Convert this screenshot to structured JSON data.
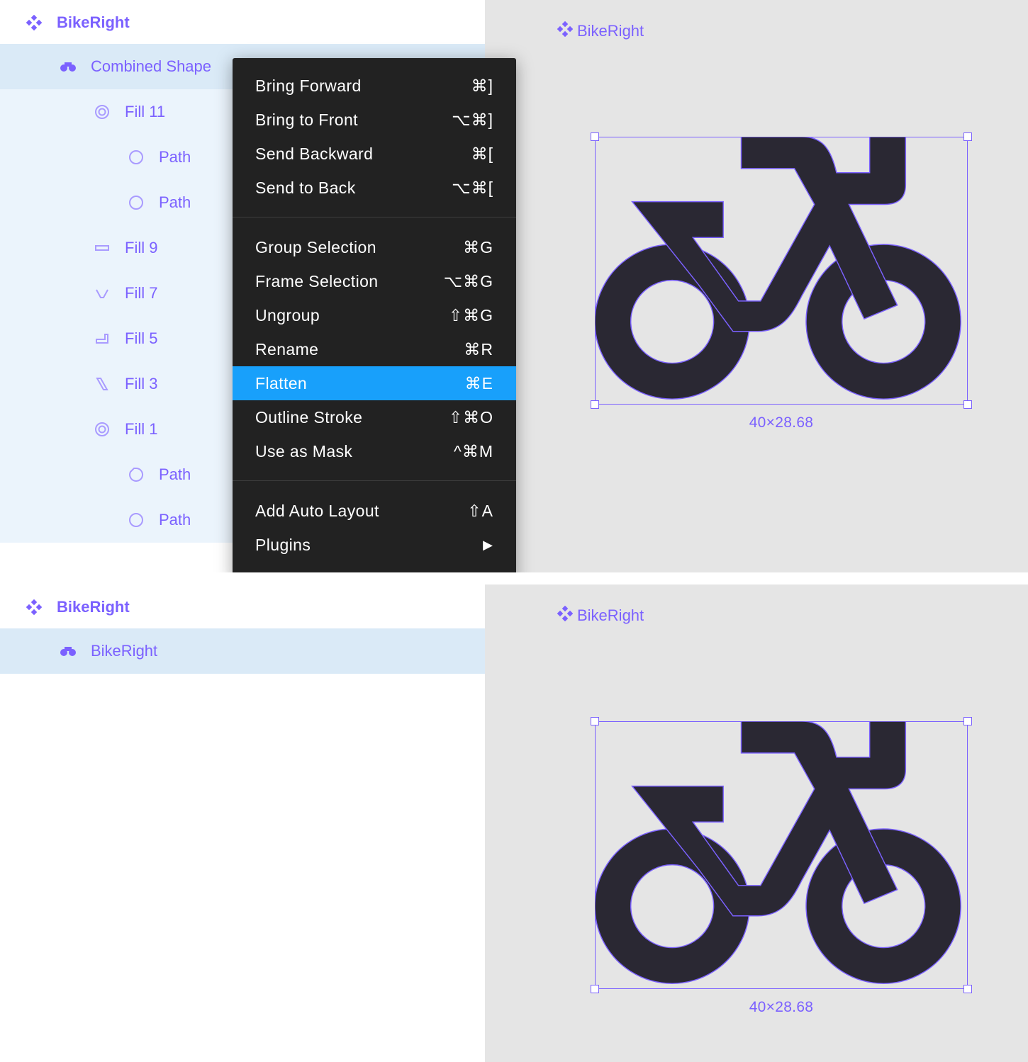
{
  "top": {
    "layers": {
      "frame_label": "BikeRight",
      "items": [
        {
          "label": "Combined Shape"
        },
        {
          "label": "Fill 11"
        },
        {
          "label": "Path"
        },
        {
          "label": "Path"
        },
        {
          "label": "Fill 9"
        },
        {
          "label": "Fill 7"
        },
        {
          "label": "Fill 5"
        },
        {
          "label": "Fill 3"
        },
        {
          "label": "Fill 1"
        },
        {
          "label": "Path"
        },
        {
          "label": "Path"
        }
      ]
    },
    "canvas": {
      "frame_label": "BikeRight",
      "dimensions": "40×28.68"
    },
    "context_menu": {
      "items": [
        {
          "label": "Bring Forward",
          "shortcut": "⌘]"
        },
        {
          "label": "Bring to Front",
          "shortcut": "⌥⌘]"
        },
        {
          "label": "Send Backward",
          "shortcut": "⌘["
        },
        {
          "label": "Send to Back",
          "shortcut": "⌥⌘["
        },
        {
          "label": "Group Selection",
          "shortcut": "⌘G"
        },
        {
          "label": "Frame Selection",
          "shortcut": "⌥⌘G"
        },
        {
          "label": "Ungroup",
          "shortcut": "⇧⌘G"
        },
        {
          "label": "Rename",
          "shortcut": "⌘R"
        },
        {
          "label": "Flatten",
          "shortcut": "⌘E"
        },
        {
          "label": "Outline Stroke",
          "shortcut": "⇧⌘O"
        },
        {
          "label": "Use as Mask",
          "shortcut": "^⌘M"
        },
        {
          "label": "Add Auto Layout",
          "shortcut": "⇧A"
        },
        {
          "label": "Plugins",
          "shortcut": "▶"
        }
      ],
      "highlighted": "Flatten"
    }
  },
  "bottom": {
    "layers": {
      "frame_label": "BikeRight",
      "items": [
        {
          "label": "BikeRight"
        }
      ]
    },
    "canvas": {
      "frame_label": "BikeRight",
      "dimensions": "40×28.68"
    }
  },
  "colors": {
    "accent": "#7b61ff",
    "selection_row": "#daeaf7",
    "selection_children": "#ebf4fc",
    "menu_bg": "#222222",
    "menu_highlight": "#18a0fb",
    "canvas_bg": "#e5e5e5",
    "icon_fill": "#2a2833"
  }
}
